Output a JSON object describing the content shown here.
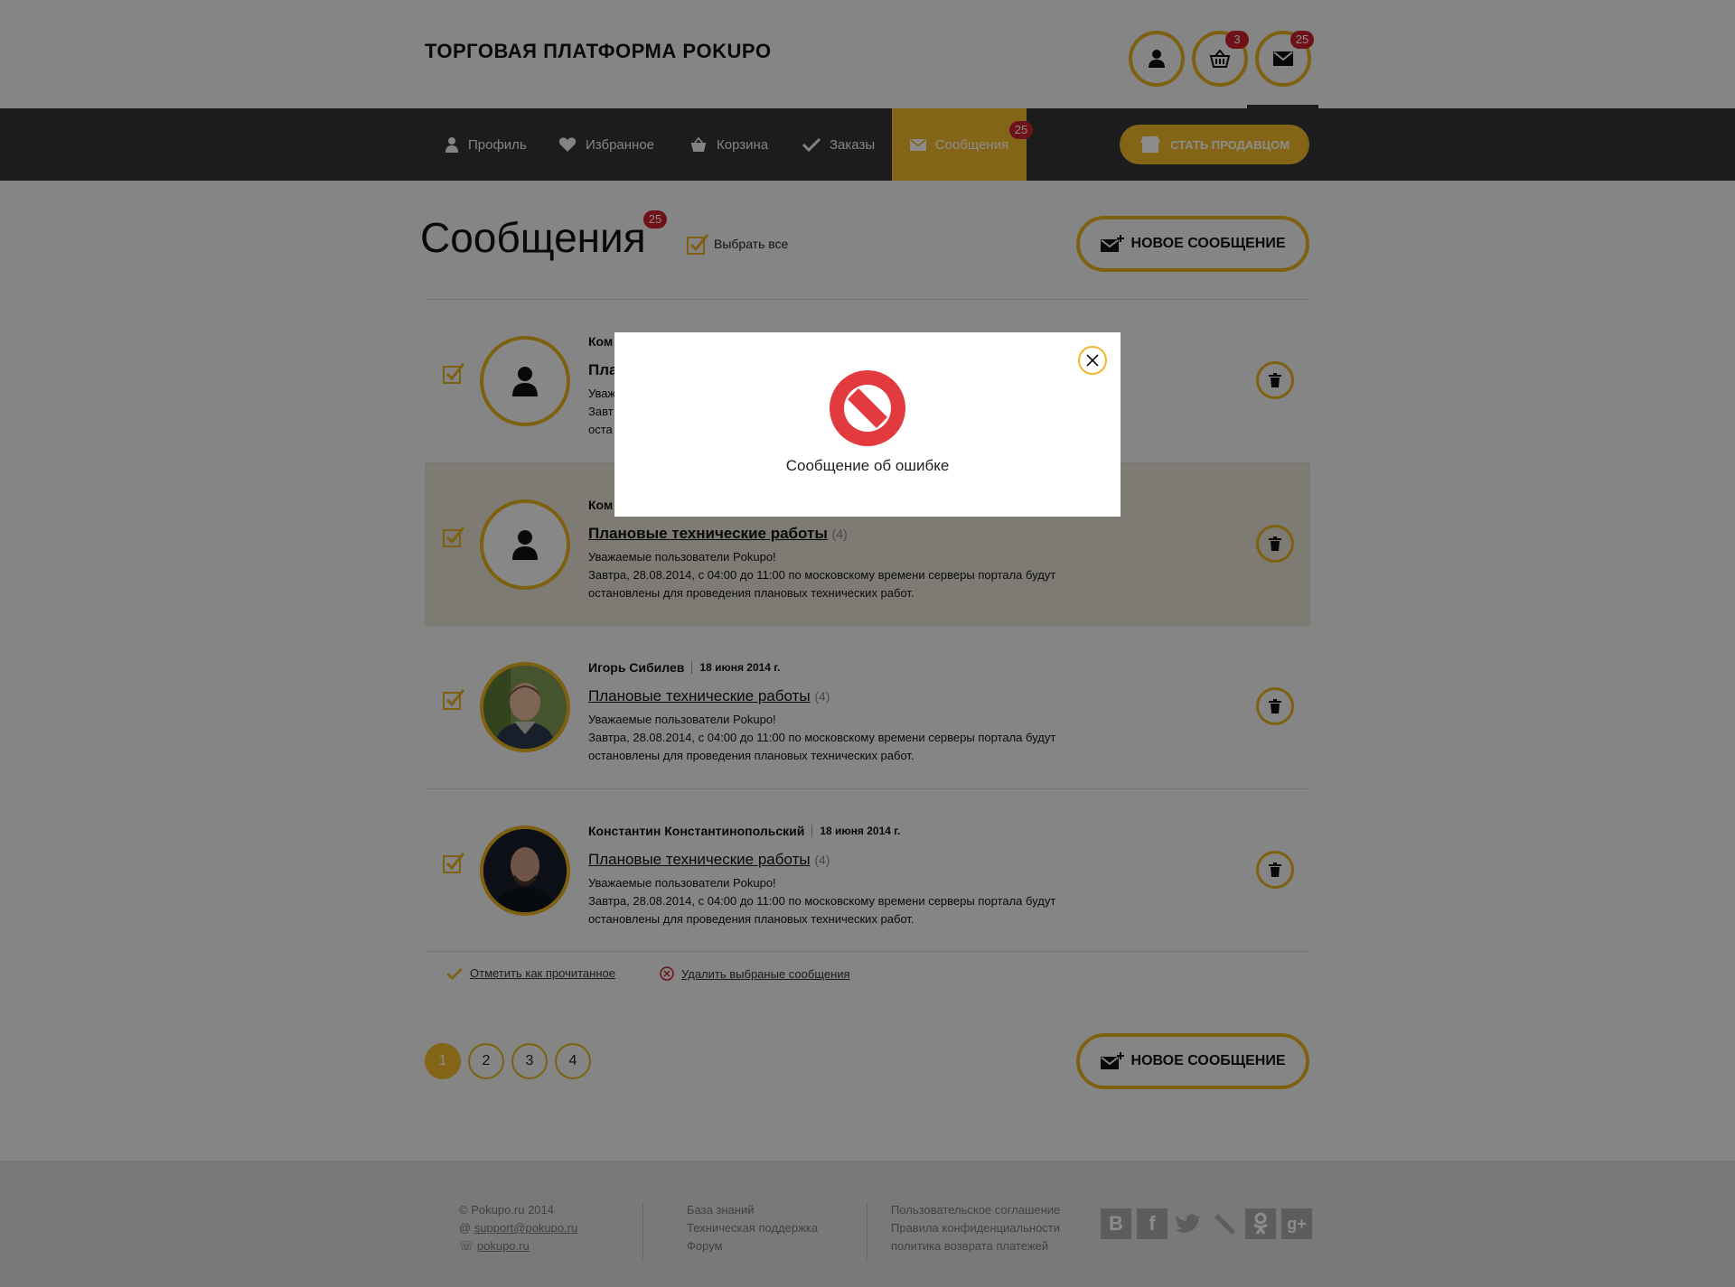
{
  "header": {
    "title": "ТОРГОВАЯ ПЛАТФОРМА POKUPO",
    "user_icon": "user-icon",
    "cart_badge": "3",
    "mail_badge": "25"
  },
  "nav": {
    "items": [
      {
        "label": "Профиль",
        "icon": "user-icon"
      },
      {
        "label": "Избранное",
        "icon": "heart-icon"
      },
      {
        "label": "Корзина",
        "icon": "basket-icon"
      },
      {
        "label": "Заказы",
        "icon": "check-icon"
      },
      {
        "label": "Сообщения",
        "icon": "envelope-icon",
        "badge": "25"
      }
    ],
    "seller_button": "СТАТЬ ПРОДАВЦОМ"
  },
  "messages_page": {
    "title": "Сообщения",
    "title_badge": "25",
    "select_all": "Выбрать все",
    "new_message": "НОВОЕ СООБЩЕНИЕ",
    "items": [
      {
        "sender": "Ком",
        "subject": "Пла",
        "count": "",
        "body": [
          "Уваж",
          "Завт",
          "оста"
        ]
      },
      {
        "sender": "Ком",
        "subject": "Плановые технические работы",
        "count": "(4)",
        "body": [
          "Уважаемые пользователи Pokupo!",
          "Завтра, 28.08.2014, с 04:00 до 11:00 по московскому времени серверы портала будут",
          "остановлены для проведения плановых технических работ."
        ]
      },
      {
        "sender": "Игорь Сибилев",
        "date": "18 июня 2014 г.",
        "subject": "Плановые технические работы",
        "count": "(4)",
        "body": [
          "Уважаемые пользователи Pokupo!",
          "Завтра, 28.08.2014, с 04:00 до 11:00 по московскому времени серверы портала будут",
          "остановлены для проведения плановых технических работ."
        ]
      },
      {
        "sender": "Константин Константинопольский",
        "date": "18 июня 2014 г.",
        "subject": "Плановые технические работы",
        "count": "(4)",
        "body": [
          "Уважаемые пользователи Pokupo!",
          "Завтра, 28.08.2014, с 04:00 до 11:00 по московскому времени серверы портала будут",
          "остановлены для проведения плановых технических работ."
        ]
      }
    ],
    "mark_read": "Отметить как прочитанное",
    "delete_selected": "Удалить выбраные сообщения",
    "pages": [
      "1",
      "2",
      "3",
      "4"
    ],
    "current_page": "1"
  },
  "footer": {
    "copyright": "Pokupo.ru 2014",
    "email": "support@pokupo.ru",
    "skype": "pokupo.ru",
    "links_1": [
      "База знаний",
      "Техническая поддержка",
      "Форум"
    ],
    "links_2": [
      "Пользовательское соглашение",
      "Правила конфиденциальности",
      "политика возврата платежей"
    ],
    "social": [
      "В",
      "f",
      "twitter-icon",
      "lj-icon",
      "ok-icon",
      "g+"
    ]
  },
  "modal": {
    "message": "Сообщение об ошибке",
    "icon": "forbidden-icon"
  },
  "colors": {
    "accent": "#f0b72a",
    "nav_bg": "#333333",
    "badge": "#c9202c",
    "error": "#e23b3f"
  }
}
